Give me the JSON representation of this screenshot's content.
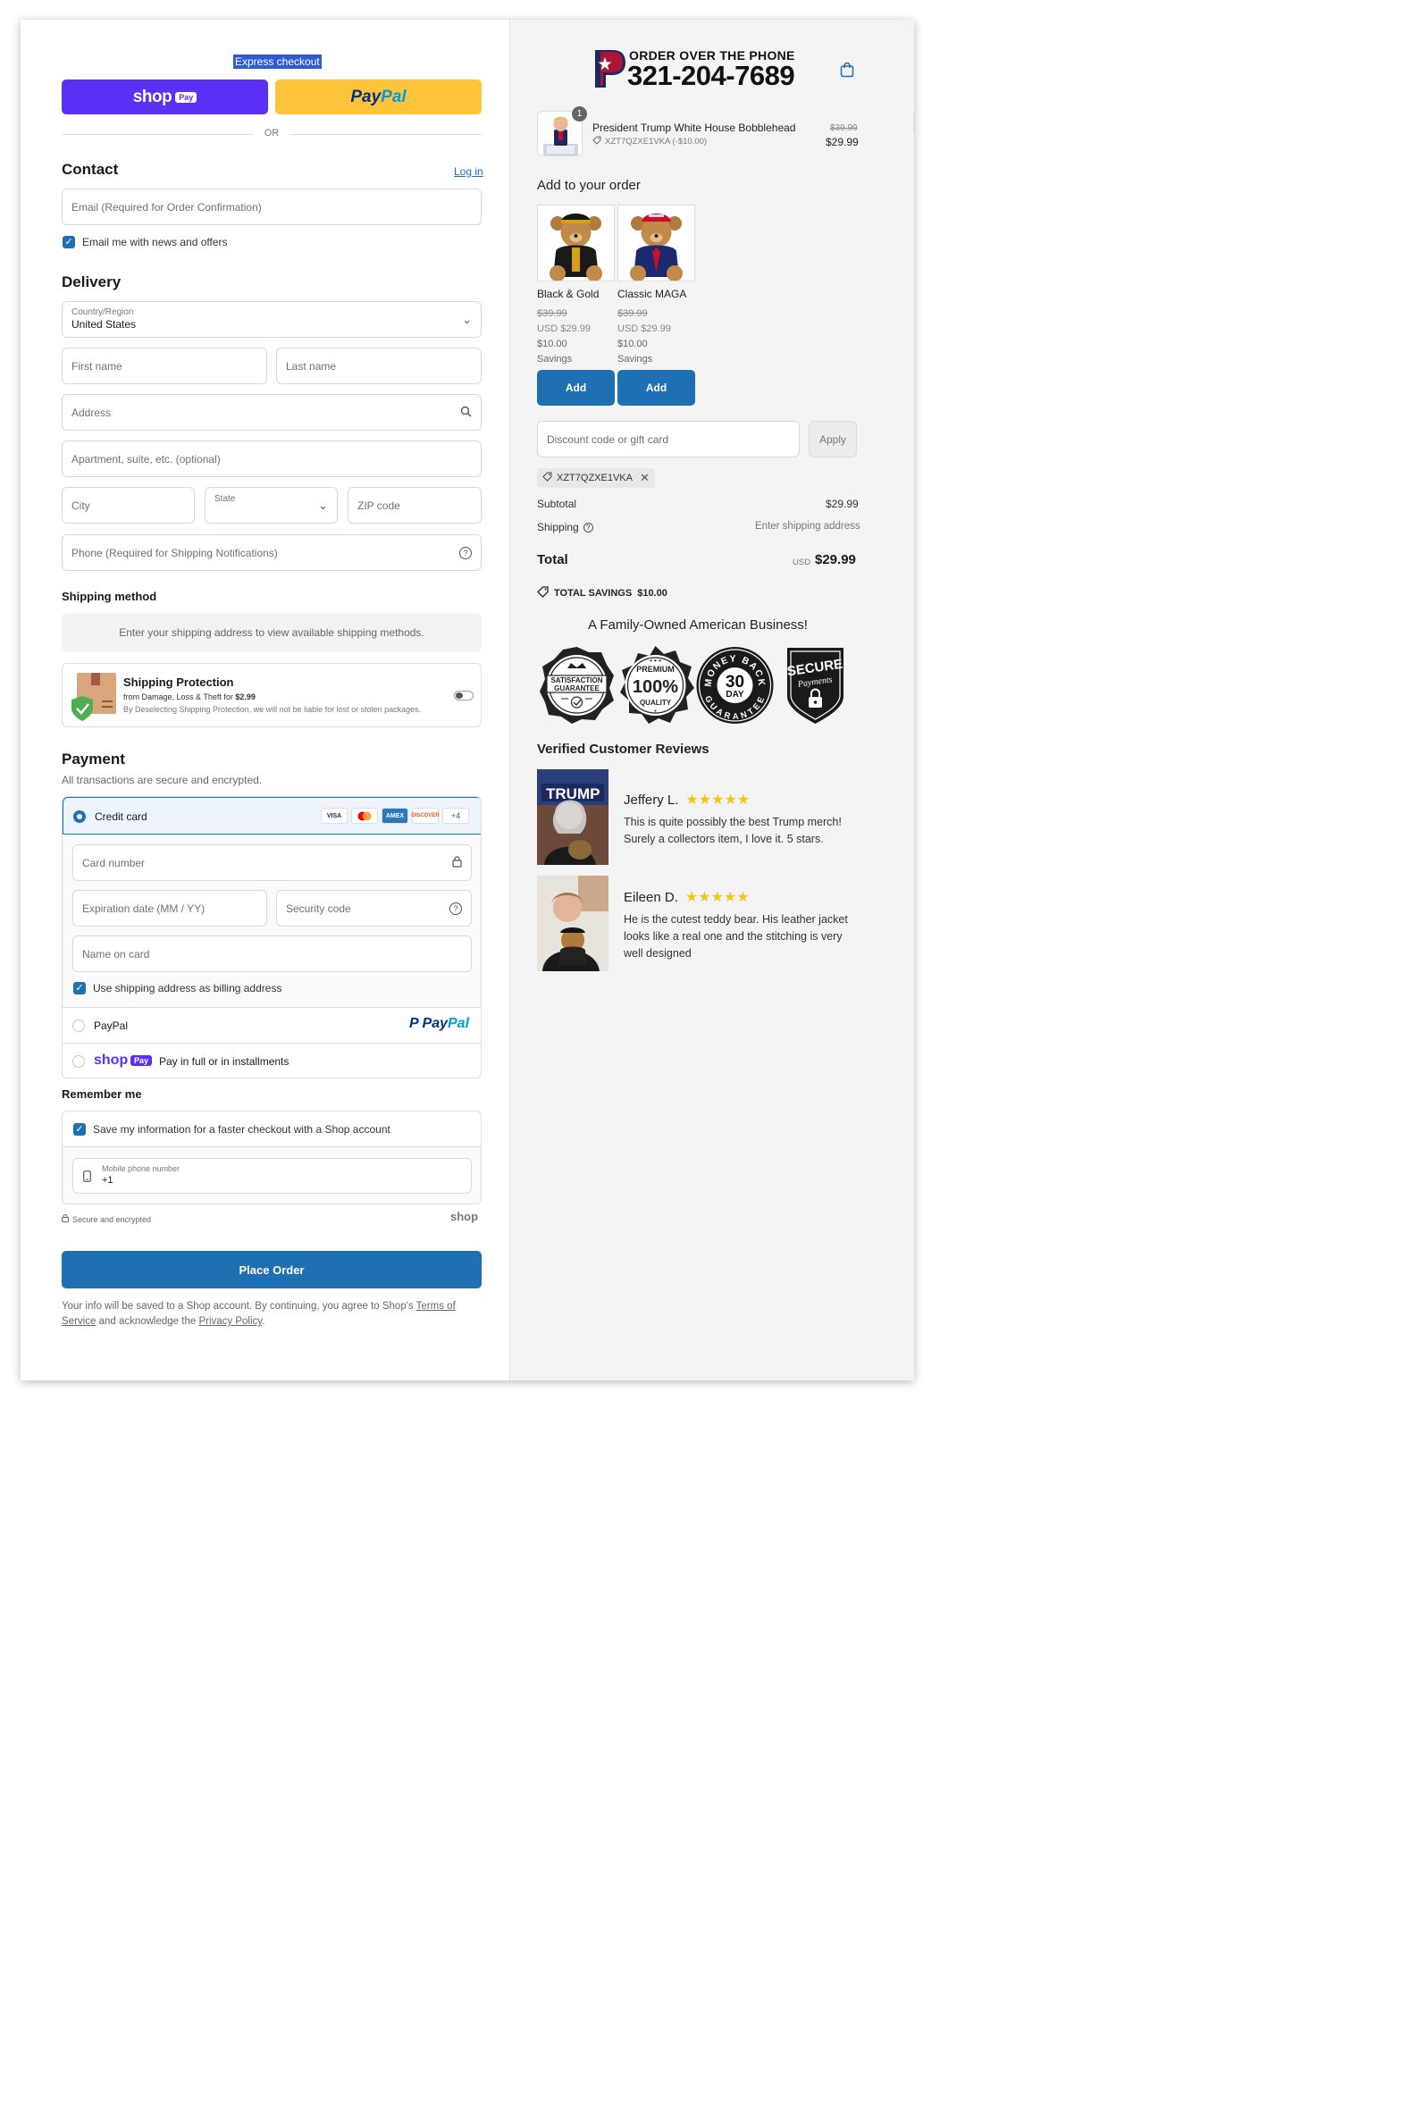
{
  "express": {
    "label": "Express checkout",
    "shop_label": "shop",
    "shop_pay_tag": "Pay",
    "paypal_pay": "Pay",
    "paypal_pal": "Pal",
    "or": "OR"
  },
  "contact": {
    "title": "Contact",
    "login": "Log in",
    "email_placeholder": "Email (Required for Order Confirmation)",
    "newsletter_label": "Email me with news and offers"
  },
  "delivery": {
    "title": "Delivery",
    "country_label": "Country/Region",
    "country_value": "United States",
    "first_name": "First name",
    "last_name": "Last name",
    "address": "Address",
    "apartment": "Apartment, suite, etc. (optional)",
    "city": "City",
    "state": "State",
    "zip": "ZIP code",
    "phone": "Phone (Required for Shipping Notifications)"
  },
  "shipping_method": {
    "title": "Shipping method",
    "message": "Enter your shipping address to view available shipping methods."
  },
  "protection": {
    "title": "Shipping Protection",
    "line1_prefix": "from Damage, Loss & Theft for",
    "price": "$2.99",
    "line2": "By Deselecting Shipping Protection, we will not be liable for lost or stolen packages."
  },
  "payment": {
    "title": "Payment",
    "subtitle": "All transactions are secure and encrypted.",
    "credit_card": "Credit card",
    "cards": [
      "VISA",
      "MC",
      "AMEX",
      "DISCOVER"
    ],
    "more_cards": "+4",
    "card_number": "Card number",
    "expiry": "Expiration date (MM / YY)",
    "security_code": "Security code",
    "name_on_card": "Name on card",
    "billing_same": "Use shipping address as billing address",
    "paypal_option": "PayPal",
    "paypal_logo_pay": "Pay",
    "paypal_logo_pal": "Pal",
    "shoppay_logo": "shop",
    "shoppay_tag": "Pay",
    "shoppay_text": "Pay in full or in installments"
  },
  "remember": {
    "title": "Remember me",
    "save_label": "Save my information for a faster checkout with a Shop account",
    "mobile_label": "Mobile phone number",
    "mobile_value": "+1",
    "secure": "Secure and encrypted",
    "shop_logo": "shop"
  },
  "place_order": "Place Order",
  "legal": {
    "text1": "Your info will be saved to a Shop account. By continuing, you agree to Shop's",
    "terms": "Terms of Service",
    "text2": "and acknowledge the",
    "privacy": "Privacy Policy",
    "end": "."
  },
  "header": {
    "logo_letter": "P",
    "order_over_phone": "ORDER OVER THE PHONE",
    "phone": "321-204-7689"
  },
  "cart": {
    "qty": "1",
    "name": "President Trump White House Bobblehead",
    "discount_code": "XZT7QZXE1VKA (-$10.00)",
    "old_price": "$39.99",
    "price": "$29.99"
  },
  "upsell": {
    "title": "Add to your order",
    "items": [
      {
        "name": "Black & Gold",
        "old_price": "$39.99",
        "price": "USD $29.99",
        "savings_amount": "$10.00",
        "savings_label": "Savings",
        "button": "Add"
      },
      {
        "name": "Classic MAGA",
        "old_price": "$39.99",
        "price": "USD $29.99",
        "savings_amount": "$10.00",
        "savings_label": "Savings",
        "button": "Add"
      }
    ]
  },
  "discount": {
    "placeholder": "Discount code or gift card",
    "apply": "Apply",
    "applied_code": "XZT7QZXE1VKA"
  },
  "summary": {
    "subtotal_label": "Subtotal",
    "subtotal_value": "$29.99",
    "shipping_label": "Shipping",
    "shipping_value": "Enter shipping address",
    "total_label": "Total",
    "currency": "USD",
    "total_value": "$29.99",
    "savings_label": "TOTAL SAVINGS",
    "savings_value": "$10.00"
  },
  "trust": {
    "headline": "A Family-Owned American Business!",
    "badges": [
      {
        "line1": "SATISFACTION",
        "line2": "GUARANTEE"
      },
      {
        "line1": "PREMIUM",
        "line2": "100%",
        "line3": "QUALITY"
      },
      {
        "line1": "MONEY BACK",
        "line2": "30",
        "line3": "DAY",
        "line4": "GUARANTEE"
      },
      {
        "line1": "SECURE",
        "line2": "Payments"
      }
    ]
  },
  "reviews": {
    "title": "Verified Customer Reviews",
    "items": [
      {
        "name": "Jeffery L.",
        "stars": 5,
        "text": "This is quite possibly the best Trump merch! Surely a collectors item, I love it. 5 stars."
      },
      {
        "name": "Eileen D.",
        "stars": 5,
        "text": "He is the cutest teddy bear. His leather jacket looks like a real one and the stitching is very well designed"
      }
    ]
  },
  "colors": {
    "primary": "#1f6fb3",
    "shop_purple": "#5a31f4",
    "paypal_yellow": "#ffc439",
    "paypal_navy": "#003087",
    "paypal_blue": "#009cde"
  }
}
